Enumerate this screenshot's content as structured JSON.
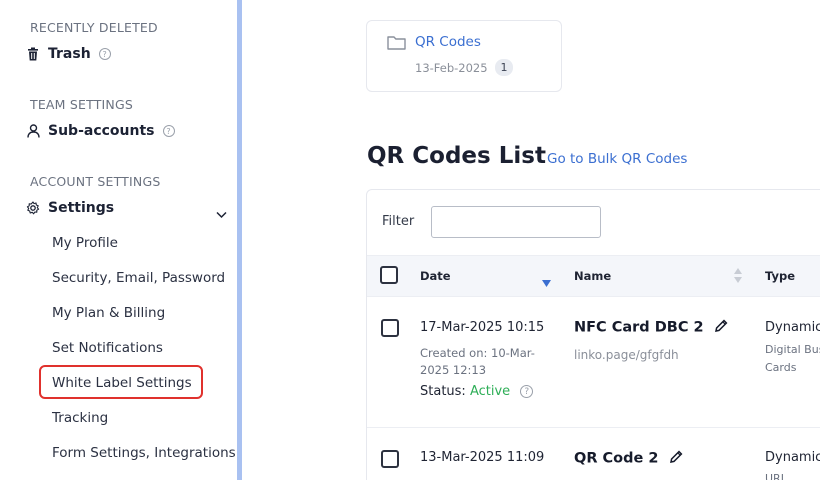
{
  "sidebar": {
    "recently_deleted_heading": "RECENTLY DELETED",
    "trash_label": "Trash",
    "team_settings_heading": "TEAM SETTINGS",
    "subaccounts_label": "Sub-accounts",
    "account_settings_heading": "ACCOUNT SETTINGS",
    "settings_label": "Settings",
    "settings_items": [
      {
        "label": "My Profile"
      },
      {
        "label": "Security, Email, Password"
      },
      {
        "label": "My Plan & Billing"
      },
      {
        "label": "Set Notifications"
      },
      {
        "label": "White Label Settings"
      },
      {
        "label": "Tracking"
      },
      {
        "label": "Form Settings, Integrations"
      }
    ],
    "icons": [
      "trash-icon",
      "user-icon",
      "gear-icon",
      "chevron-down-icon",
      "help-icon"
    ],
    "highlight_color": "#e0312d"
  },
  "folder": {
    "name": "QR Codes",
    "date": "13-Feb-2025",
    "count": "1"
  },
  "main": {
    "title": "QR Codes List",
    "bulk_link": "Go to Bulk QR Codes",
    "filter_label": "Filter",
    "filter_value": ""
  },
  "table": {
    "headers": {
      "date": "Date",
      "name": "Name",
      "type": "Type"
    },
    "rows": [
      {
        "date": "17-Mar-2025 10:15",
        "created": "Created on: 10-Mar-2025 12:13",
        "status_label": "Status:",
        "status_value": "Active",
        "name": "NFC Card DBC 2",
        "url": "linko.page/gfgfdh",
        "type": "Dynamic",
        "type_sub1": "Digital Business",
        "type_sub2": "Cards"
      },
      {
        "date": "13-Mar-2025 11:09",
        "name": "QR Code 2",
        "type": "Dynamic",
        "type_sub1": "URL"
      }
    ]
  },
  "colors": {
    "accent": "#3b6fd1",
    "active_status": "#2eae57",
    "sidebar_border": "#a9c1f1"
  }
}
